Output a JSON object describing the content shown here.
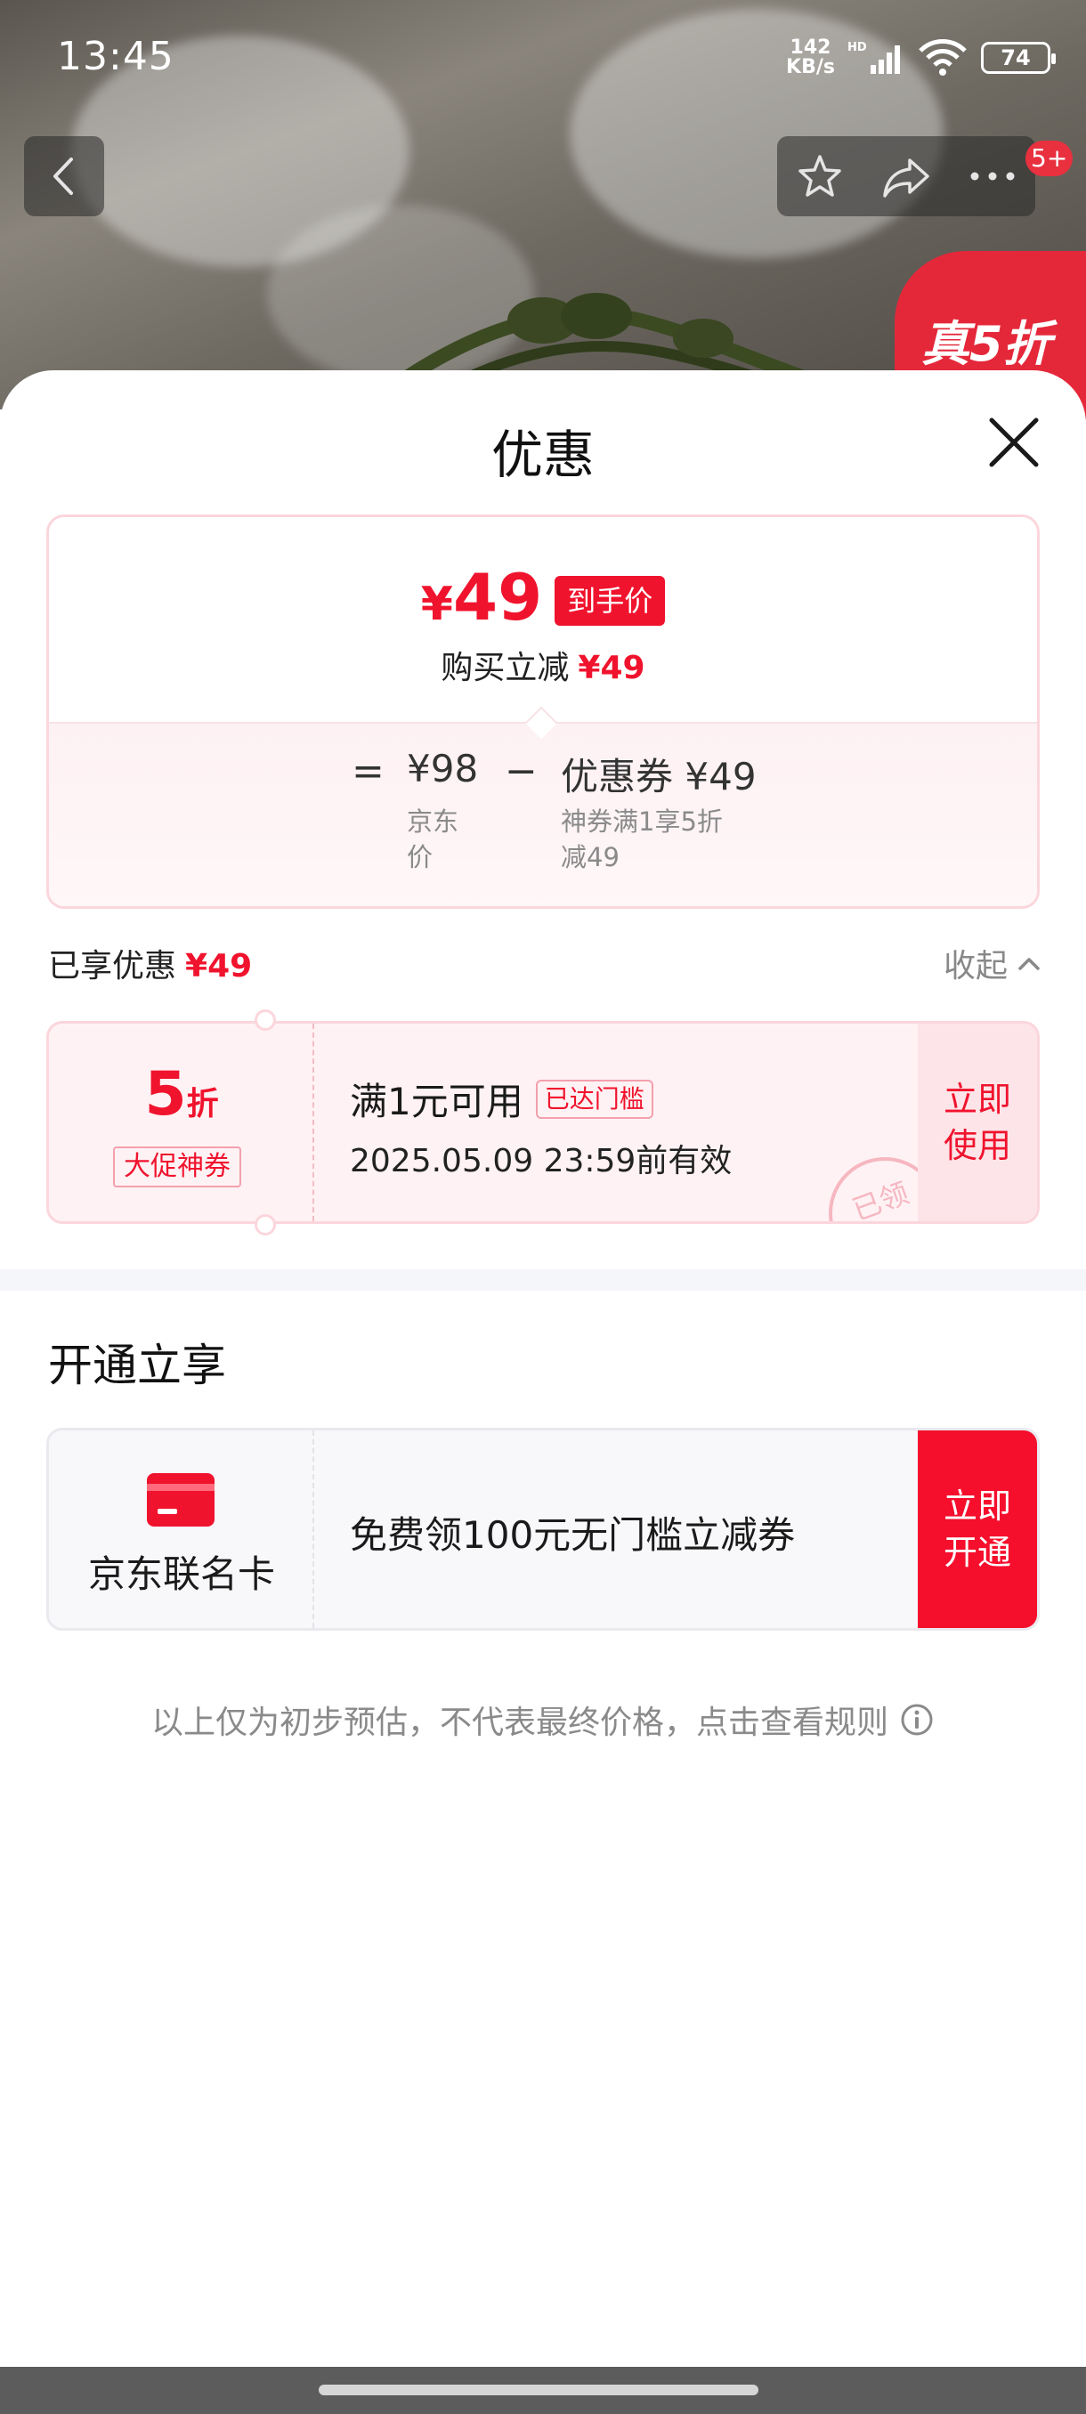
{
  "status_bar": {
    "time": "13:45",
    "net_speed_value": "142",
    "net_speed_unit": "KB/s",
    "network_type": "HD",
    "battery": "74"
  },
  "top_nav": {
    "notification_count": "5+",
    "promo_tag": "真5折"
  },
  "sheet": {
    "title": "优惠"
  },
  "price_card": {
    "currency": "¥",
    "final_price": "49",
    "final_tag": "到手价",
    "instant_reduction_label": "购买立减",
    "instant_reduction_value": "¥49",
    "equals": "=",
    "base_price": "¥98",
    "base_price_label_line1": "京东",
    "base_price_label_line2": "价",
    "minus": "−",
    "coupon_label": "优惠券",
    "coupon_value": "¥49",
    "coupon_note_line1": "神券满1享5折",
    "coupon_note_line2": "减49"
  },
  "enjoyed": {
    "label": "已享优惠",
    "value": "¥49",
    "collapse_label": "收起"
  },
  "coupon": {
    "discount_number": "5",
    "discount_unit": "折",
    "type": "大促神券",
    "condition": "满1元可用",
    "status_badge": "已达门槛",
    "expiry": "2025.05.09 23:59前有效",
    "stamp": "已领",
    "action_line1": "立即",
    "action_line2": "使用"
  },
  "membership": {
    "section_title": "开通立享",
    "card_name": "京东联名卡",
    "offer": "免费领100元无门槛立减券",
    "action_line1": "立即",
    "action_line2": "开通"
  },
  "disclaimer": "以上仅为初步预估，不代表最终价格，点击查看规则",
  "colors": {
    "accent_red": "#f0132d",
    "card_border_pink": "#fbd6dc",
    "coupon_bg": "#fff2f4"
  }
}
